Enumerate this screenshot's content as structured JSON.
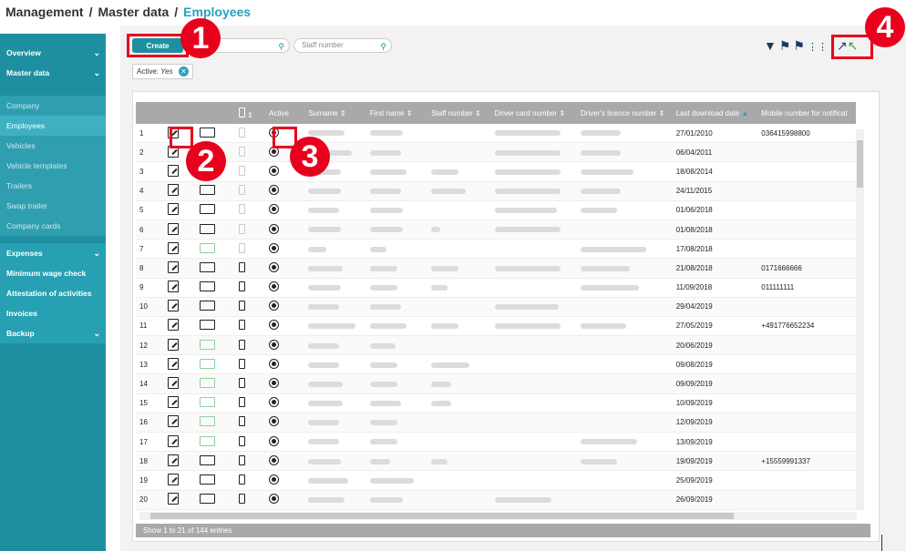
{
  "breadcrumb": {
    "part1": "Management",
    "sep": "/",
    "part2": "Master data",
    "current": "Employees"
  },
  "sidebar": {
    "overview": "Overview",
    "master_data": "Master data",
    "master_items": [
      "Company",
      "Employees",
      "Vehicles",
      "Vehicle templates",
      "Trailers",
      "Swap trailer",
      "Company cards"
    ],
    "expenses": "Expenses",
    "expense_items": [
      "Minimum wage check",
      "Attestation of activities",
      "Invoices"
    ],
    "backup": "Backup"
  },
  "toolbar": {
    "create_label": "Create",
    "surname_placeholder": "me",
    "staff_number_placeholder": "Staff number",
    "filter_chip_label": "Active:",
    "filter_chip_value": "Yes"
  },
  "badges": [
    "1",
    "2",
    "3",
    "4"
  ],
  "columns": [
    "",
    "",
    "",
    "",
    "Active",
    "Surname",
    "First name",
    "Staff number",
    "Driver card number",
    "Driver's licence number",
    "Last download date",
    "Mobile number for notificat"
  ],
  "rows": [
    {
      "n": "1",
      "date": "27/01/2010",
      "mobile": "036415998800"
    },
    {
      "n": "2",
      "date": "06/04/2011",
      "mobile": ""
    },
    {
      "n": "3",
      "date": "18/08/2014",
      "mobile": ""
    },
    {
      "n": "4",
      "date": "24/11/2015",
      "mobile": ""
    },
    {
      "n": "5",
      "date": "01/06/2018",
      "mobile": ""
    },
    {
      "n": "6",
      "date": "01/08/2018",
      "mobile": ""
    },
    {
      "n": "7",
      "date": "17/08/2018",
      "mobile": ""
    },
    {
      "n": "8",
      "date": "21/08/2018",
      "mobile": "0171666666"
    },
    {
      "n": "9",
      "date": "11/09/2018",
      "mobile": "011111111"
    },
    {
      "n": "10",
      "date": "29/04/2019",
      "mobile": ""
    },
    {
      "n": "11",
      "date": "27/05/2019",
      "mobile": "+491776652234"
    },
    {
      "n": "12",
      "date": "20/06/2019",
      "mobile": ""
    },
    {
      "n": "13",
      "date": "09/08/2019",
      "mobile": ""
    },
    {
      "n": "14",
      "date": "09/09/2019",
      "mobile": ""
    },
    {
      "n": "15",
      "date": "10/09/2019",
      "mobile": ""
    },
    {
      "n": "16",
      "date": "12/09/2019",
      "mobile": ""
    },
    {
      "n": "17",
      "date": "13/09/2019",
      "mobile": ""
    },
    {
      "n": "18",
      "date": "19/09/2019",
      "mobile": "+15559991337"
    },
    {
      "n": "19",
      "date": "25/09/2019",
      "mobile": ""
    },
    {
      "n": "20",
      "date": "26/09/2019",
      "mobile": ""
    }
  ],
  "footer": "Show 1 to 21 of 144 entries",
  "colors": {
    "accent": "#1e8fa0",
    "highlight": "#e8001c",
    "header": "#a9a9a9"
  }
}
